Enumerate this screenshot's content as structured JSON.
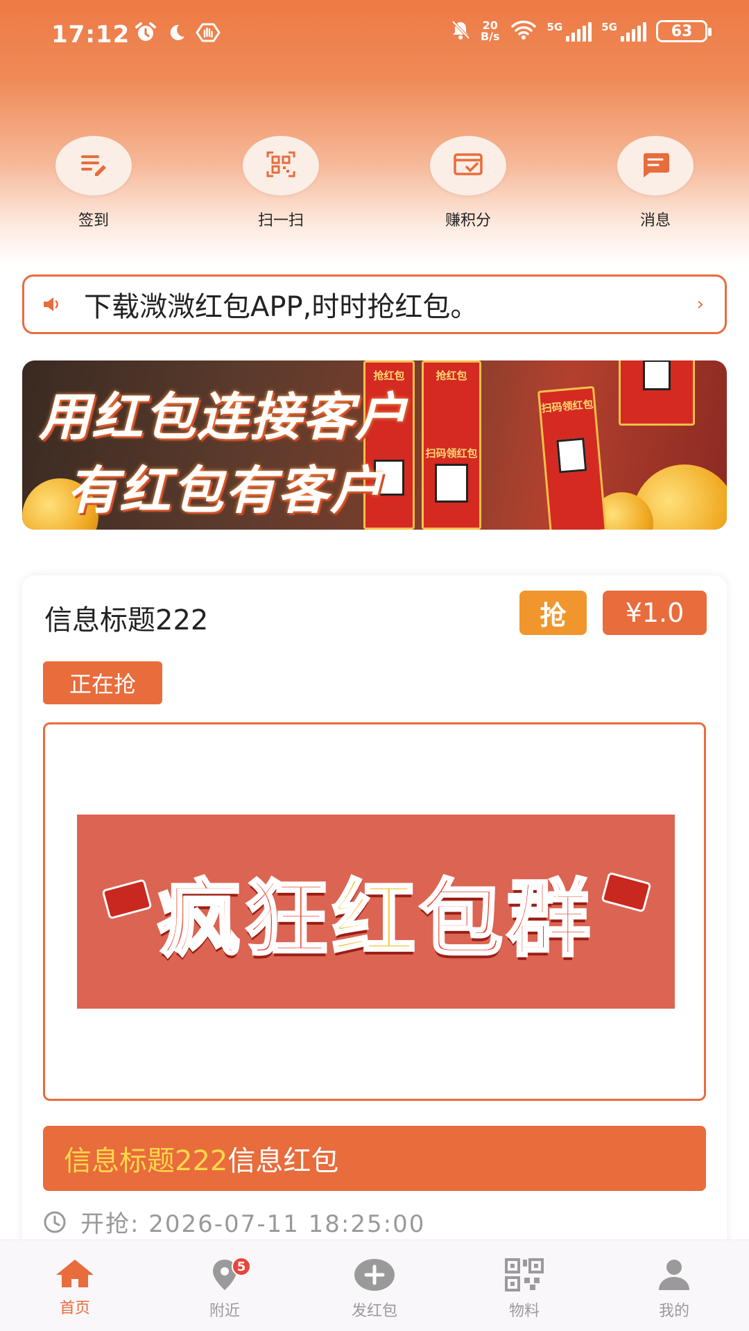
{
  "status_bar": {
    "time": "17:12",
    "net_speed_value": "20",
    "net_speed_unit": "B/s",
    "signal_1": "5G",
    "signal_2": "5G",
    "battery": "63"
  },
  "quick_actions": [
    {
      "label": "签到",
      "icon": "edit-note-icon"
    },
    {
      "label": "扫一扫",
      "icon": "qr-scan-icon"
    },
    {
      "label": "赚积分",
      "icon": "points-card-icon"
    },
    {
      "label": "消息",
      "icon": "message-icon"
    }
  ],
  "notice": {
    "text": "下载溦溦红包APP,时时抢红包。",
    "icon": "speaker-icon"
  },
  "banner": {
    "line1": "用红包连接客户",
    "line2": "有红包有客户",
    "poster_text_1": "抢红包",
    "poster_text_2": "扫码领红包"
  },
  "card": {
    "title": "信息标题222",
    "grab_label": "抢",
    "price": "¥1.0",
    "status": "正在抢",
    "promo_text_part1": "疯狂",
    "promo_text_part2": "红",
    "promo_text_part3": "包群",
    "desc_title": "信息标题222",
    "desc_suffix": "信息红包",
    "time_label": "开抢: 2026-07-11 18:25:00"
  },
  "tabs": [
    {
      "label": "首页",
      "icon": "home-icon",
      "active": true
    },
    {
      "label": "附近",
      "icon": "location-pin-icon",
      "badge": "5"
    },
    {
      "label": "发红包",
      "icon": "plus-circle-icon"
    },
    {
      "label": "物料",
      "icon": "qr-code-icon"
    },
    {
      "label": "我的",
      "icon": "user-icon"
    }
  ],
  "colors": {
    "accent": "#e86c3c",
    "grab": "#f0962c",
    "highlight_text": "#ffd84a",
    "inactive_tab": "#999999"
  }
}
